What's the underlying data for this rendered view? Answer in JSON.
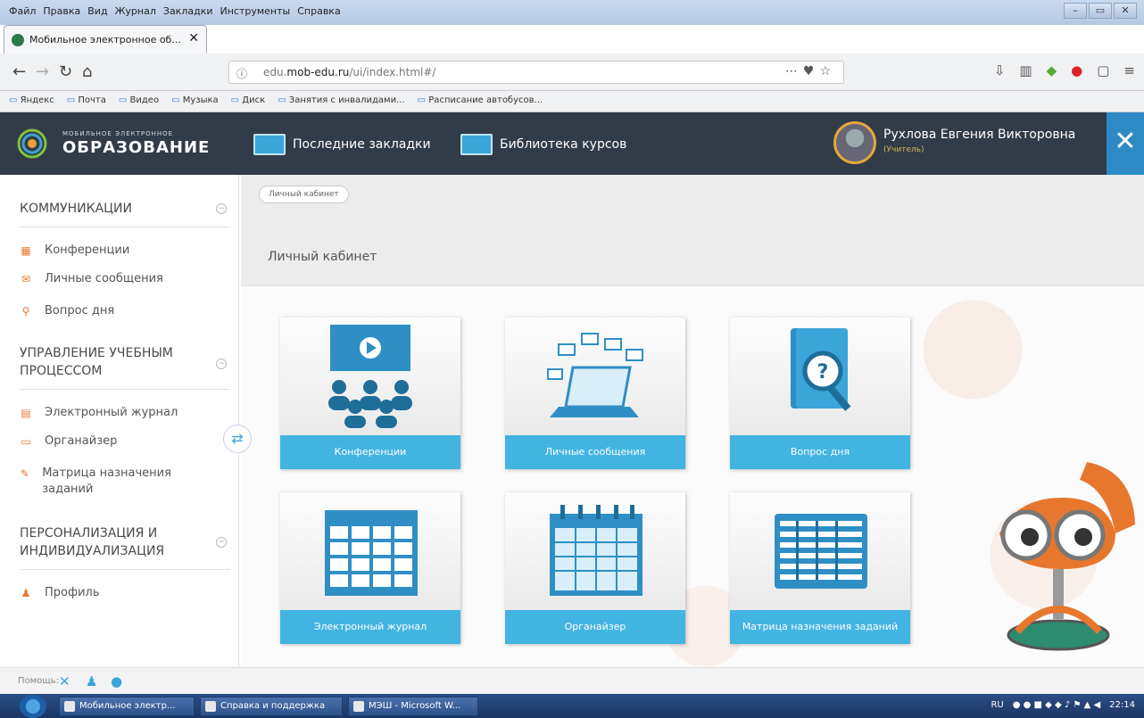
{
  "browser": {
    "menu": [
      "Файл",
      "Правка",
      "Вид",
      "Журнал",
      "Закладки",
      "Инструменты",
      "Справка"
    ],
    "tab_title": "Мобильное электронное об...",
    "url_prefix": "edu.",
    "url_domain": "mob-edu.ru",
    "url_path": "/ui/index.html#/",
    "bookmarks": [
      "Яндекс",
      "Почта",
      "Видео",
      "Музыка",
      "Диск",
      "Занятия с инвалидами...",
      "Расписание автобусов..."
    ]
  },
  "header": {
    "logo_small": "МОБИЛЬНОЕ ЭЛЕКТРОННОЕ",
    "logo_big": "ОБРАЗОВАНИЕ",
    "nav": [
      {
        "label": "Последние закладки",
        "icon": "bookmarks-icon"
      },
      {
        "label": "Библиотека курсов",
        "icon": "course-library-icon"
      }
    ],
    "user_name": "Рухлова Евгения Викторовна",
    "user_role": "(Учитель)"
  },
  "sidebar": {
    "sections": [
      {
        "title": "КОММУНИКАЦИИ",
        "items": [
          "Конференции",
          "Личные сообщения",
          "Вопрос дня"
        ]
      },
      {
        "title": "УПРАВЛЕНИЕ УЧЕБНЫМ ПРОЦЕССОМ",
        "items": [
          "Электронный журнал",
          "Органайзер",
          "Матрица назначения заданий"
        ]
      },
      {
        "title": "ПЕРСОНАЛИЗАЦИЯ И ИНДИВИДУАЛИЗАЦИЯ",
        "items": [
          "Профиль"
        ]
      }
    ]
  },
  "content": {
    "breadcrumb": "Личный кабинет",
    "page_title": "Личный кабинет",
    "tiles": [
      "Конференции",
      "Личные сообщения",
      "Вопрос дня",
      "Электронный журнал",
      "Органайзер",
      "Матрица назначения заданий"
    ]
  },
  "helpbar": {
    "label": "Помощь:"
  },
  "taskbar": {
    "buttons": [
      "Мобильное электр...",
      "Справка и поддержка",
      "МЭШ - Microsoft W..."
    ],
    "lang": "RU",
    "time": "22:14"
  },
  "colors": {
    "header_bg": "#323b48",
    "accent": "#42b4e2",
    "sidebar_icon": "#e8772e",
    "user_role": "#d4b45b"
  }
}
